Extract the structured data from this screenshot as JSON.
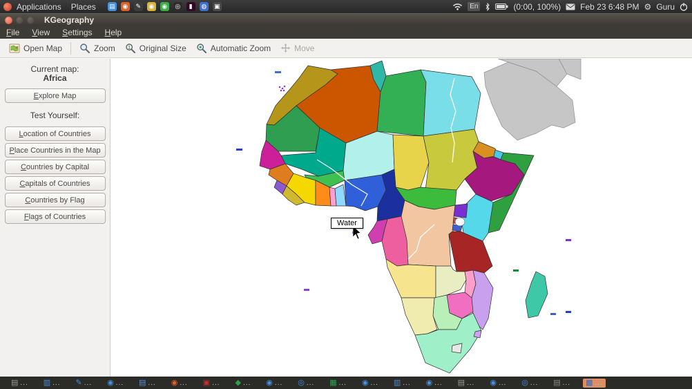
{
  "panel": {
    "applications": "Applications",
    "places": "Places",
    "app_icons": [
      {
        "name": "files",
        "glyph": "▤",
        "color": "#4a90d9"
      },
      {
        "name": "browser",
        "glyph": "◉",
        "color": "#e0622b"
      },
      {
        "name": "editor",
        "glyph": "✎",
        "color": "#3d3d3d"
      },
      {
        "name": "chrome",
        "glyph": "◉",
        "color": "#d8b43a"
      },
      {
        "name": "media",
        "glyph": "◉",
        "color": "#3fae4a"
      },
      {
        "name": "dark-app",
        "glyph": "◎",
        "color": "#2d2d2d"
      },
      {
        "name": "terminal",
        "glyph": "▮",
        "color": "#300a24"
      },
      {
        "name": "chat",
        "glyph": "◍",
        "color": "#3f6fd0"
      },
      {
        "name": "camera",
        "glyph": "▣",
        "color": "#4a4a4a"
      }
    ],
    "en_label": "En",
    "battery_text": "(0:00, 100%)",
    "datetime": "Feb 23  6:48 PM",
    "gear_glyph": "⚙",
    "user": "Guru"
  },
  "window": {
    "title": "KGeography"
  },
  "menus": [
    "File",
    "View",
    "Settings",
    "Help"
  ],
  "toolbar": {
    "open_map": "Open Map",
    "zoom": "Zoom",
    "original_size": "Original Size",
    "automatic_zoom": "Automatic Zoom",
    "move": "Move"
  },
  "sidebar": {
    "current_map_label": "Current map:",
    "current_map": "Africa",
    "explore": "Explore Map",
    "test_label": "Test Yourself:",
    "buttons": [
      "Location of Countries",
      "Place Countries in the Map",
      "Countries by Capital",
      "Capitals of Countries",
      "Countries by Flag",
      "Flags of Countries"
    ]
  },
  "map": {
    "tooltip": "Water",
    "colors": {
      "morocco": "#b5951a",
      "algeria": "#cc5500",
      "tunisia": "#2fb8a8",
      "libya": "#33b054",
      "egypt": "#7adee8",
      "mauritania": "#2f9e50",
      "mali": "#00a98c",
      "senegal": "#cc1f99",
      "guinea": "#e07c20",
      "sierra_leone": "#8a5ad0",
      "liberia": "#d0b830",
      "ivory_coast": "#f5d800",
      "burkina_faso": "#3fc050",
      "ghana": "#ff8c1a",
      "togo": "#ff9ed0",
      "benin": "#90d8ff",
      "niger": "#b2f0ec",
      "nigeria": "#2f5fd9",
      "chad": "#e8d44a",
      "sudan": "#c9c93e",
      "cameroon": "#1b2f9e",
      "central_african_republic": "#3dbb3d",
      "eritrea": "#d89020",
      "djibouti": "#49c8e8",
      "ethiopia": "#a5187d",
      "somalia": "#2fa040",
      "kenya": "#55d8ea",
      "uganda": "#7a2fd0",
      "rwanda": "#d04040",
      "burundi": "#4060d0",
      "tanzania": "#a82525",
      "drc": "#f2c6a0",
      "congo": "#ee5fa0",
      "gabon": "#d03fb0",
      "angola": "#f7e48e",
      "zambia": "#e9eec2",
      "malawi": "#ff9ec8",
      "mozambique": "#c9a0ee",
      "zimbabwe": "#f06fc0",
      "botswana": "#b8f0b8",
      "namibia": "#f0ecb0",
      "south_africa": "#9ff0c8",
      "lesotho": "#e8e8e8",
      "swaziland": "#d0a0f0",
      "madagascar": "#3fc8a8",
      "arabia": "#c6c6c6",
      "canary": "#3f6fd0",
      "madeira": "#8a3fd0",
      "cape_verde": "#2f3fd0",
      "sao_tome": "#8030d0",
      "st_helena": "#9040d0",
      "comoros": "#8030d0",
      "seychelles": "#109030",
      "mauritius": "#2040c0",
      "reunion": "#4060c8"
    }
  },
  "taskbar": {
    "active_bg": "#dd8f63",
    "items": [
      {
        "glyph": "▤",
        "color": "#9a9a9a",
        "label": "..."
      },
      {
        "glyph": "▥",
        "color": "#4a90d9",
        "label": "..."
      },
      {
        "glyph": "✎",
        "color": "#4a90d9",
        "label": "..."
      },
      {
        "glyph": "◉",
        "color": "#4a90d9",
        "label": "..."
      },
      {
        "glyph": "▤",
        "color": "#5b8fd0",
        "label": "..."
      },
      {
        "glyph": "◉",
        "color": "#e0622b",
        "label": "..."
      },
      {
        "glyph": "▣",
        "color": "#c03030",
        "label": "..."
      },
      {
        "glyph": "◆",
        "color": "#2fa050",
        "label": "..."
      },
      {
        "glyph": "◉",
        "color": "#4a90d9",
        "label": "..."
      },
      {
        "glyph": "◎",
        "color": "#4a90d9",
        "label": "..."
      },
      {
        "glyph": "▦",
        "color": "#2fa050",
        "label": "..."
      },
      {
        "glyph": "◉",
        "color": "#4a90d9",
        "label": "..."
      },
      {
        "glyph": "▥",
        "color": "#4a90d9",
        "label": "..."
      },
      {
        "glyph": "◉",
        "color": "#4a90d9",
        "label": "..."
      },
      {
        "glyph": "▤",
        "color": "#9a9a9a",
        "label": "..."
      },
      {
        "glyph": "◉",
        "color": "#4a90d9",
        "label": "..."
      },
      {
        "glyph": "◎",
        "color": "#4a90d9",
        "label": "..."
      },
      {
        "glyph": "▤",
        "color": "#8a8a8a",
        "label": "..."
      },
      {
        "glyph": "▩",
        "color": "#2f6fd0",
        "label": "..."
      }
    ]
  }
}
